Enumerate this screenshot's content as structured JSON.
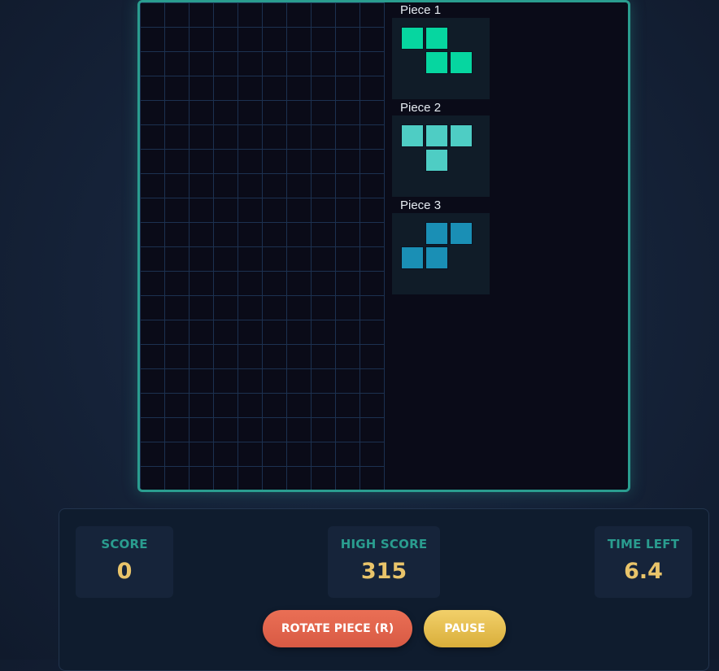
{
  "board": {
    "columns": 10,
    "rows": 20,
    "filled_cells": []
  },
  "pieces": [
    {
      "label": "Piece 1",
      "shape": "Z",
      "color": "#06d6a0",
      "cells": [
        [
          0,
          0
        ],
        [
          1,
          0
        ],
        [
          1,
          1
        ],
        [
          2,
          1
        ]
      ]
    },
    {
      "label": "Piece 2",
      "shape": "T",
      "color": "#4ecdc4",
      "cells": [
        [
          0,
          0
        ],
        [
          1,
          0
        ],
        [
          2,
          0
        ],
        [
          1,
          1
        ]
      ]
    },
    {
      "label": "Piece 3",
      "shape": "S",
      "color": "#1a8fb5",
      "cells": [
        [
          1,
          0
        ],
        [
          2,
          0
        ],
        [
          0,
          1
        ],
        [
          1,
          1
        ]
      ]
    }
  ],
  "stats": {
    "score": {
      "label": "SCORE",
      "value": "0"
    },
    "high_score": {
      "label": "HIGH SCORE",
      "value": "315"
    },
    "time_left": {
      "label": "TIME LEFT",
      "value": "6.4"
    }
  },
  "controls": {
    "rotate_label": "ROTATE PIECE (R)",
    "pause_label": "PAUSE"
  },
  "colors": {
    "accent": "#2a9d8f",
    "stat_value": "#e9c46a",
    "rotate_button": "#e76f51",
    "pause_button": "#e9c46a",
    "board_background": "#0a0b18"
  }
}
